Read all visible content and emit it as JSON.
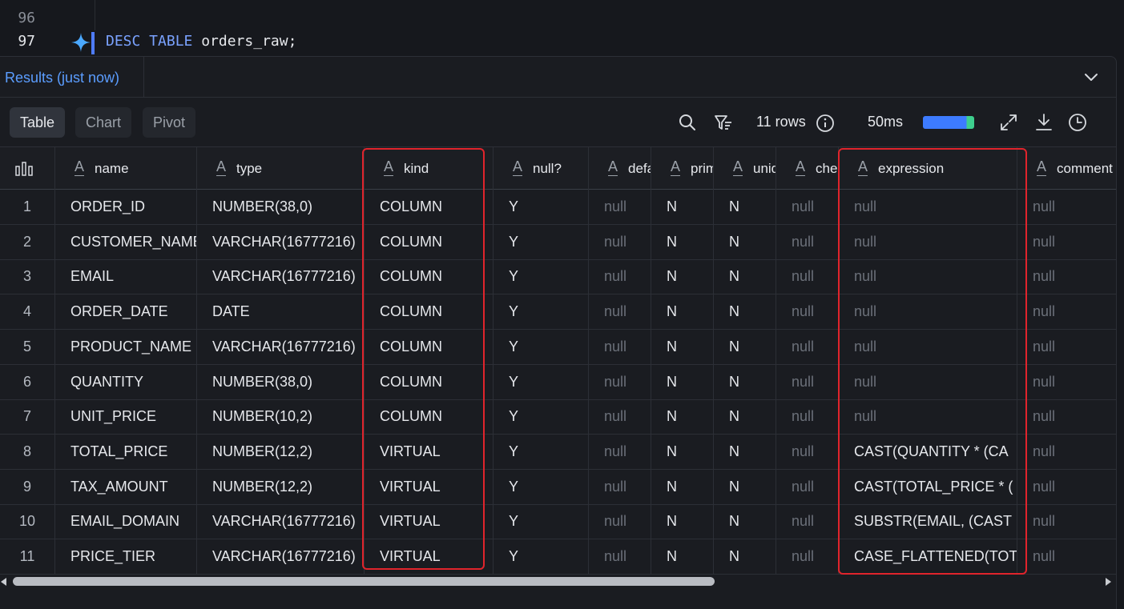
{
  "editor": {
    "lines": [
      "96",
      "97"
    ],
    "code_keyword": "DESC TABLE",
    "code_rest": " orders_raw;"
  },
  "results": {
    "tab_label": "Results (just now)"
  },
  "toolbar": {
    "tabs": [
      "Table",
      "Chart",
      "Pivot"
    ],
    "active_tab": "Table",
    "rows_count": "11 rows",
    "elapsed": "50ms",
    "progress": 1.0
  },
  "table": {
    "type_icon": "A",
    "columns": [
      "name",
      "type",
      "kind",
      "null?",
      "default",
      "primary key",
      "unique key",
      "check",
      "expression",
      "comment"
    ],
    "rows": [
      [
        "1",
        "ORDER_ID",
        "NUMBER(38,0)",
        "COLUMN",
        "Y",
        "null",
        "N",
        "N",
        "null",
        "null",
        "null"
      ],
      [
        "2",
        "CUSTOMER_NAME",
        "VARCHAR(16777216)",
        "COLUMN",
        "Y",
        "null",
        "N",
        "N",
        "null",
        "null",
        "null"
      ],
      [
        "3",
        "EMAIL",
        "VARCHAR(16777216)",
        "COLUMN",
        "Y",
        "null",
        "N",
        "N",
        "null",
        "null",
        "null"
      ],
      [
        "4",
        "ORDER_DATE",
        "DATE",
        "COLUMN",
        "Y",
        "null",
        "N",
        "N",
        "null",
        "null",
        "null"
      ],
      [
        "5",
        "PRODUCT_NAME",
        "VARCHAR(16777216)",
        "COLUMN",
        "Y",
        "null",
        "N",
        "N",
        "null",
        "null",
        "null"
      ],
      [
        "6",
        "QUANTITY",
        "NUMBER(38,0)",
        "COLUMN",
        "Y",
        "null",
        "N",
        "N",
        "null",
        "null",
        "null"
      ],
      [
        "7",
        "UNIT_PRICE",
        "NUMBER(10,2)",
        "COLUMN",
        "Y",
        "null",
        "N",
        "N",
        "null",
        "null",
        "null"
      ],
      [
        "8",
        "TOTAL_PRICE",
        "NUMBER(12,2)",
        "VIRTUAL",
        "Y",
        "null",
        "N",
        "N",
        "null",
        "CAST(QUANTITY * (CA",
        "null"
      ],
      [
        "9",
        "TAX_AMOUNT",
        "NUMBER(12,2)",
        "VIRTUAL",
        "Y",
        "null",
        "N",
        "N",
        "null",
        "CAST(TOTAL_PRICE * (",
        "null"
      ],
      [
        "10",
        "EMAIL_DOMAIN",
        "VARCHAR(16777216)",
        "VIRTUAL",
        "Y",
        "null",
        "N",
        "N",
        "null",
        "SUBSTR(EMAIL, (CAST",
        "null"
      ],
      [
        "11",
        "PRICE_TIER",
        "VARCHAR(16777216)",
        "VIRTUAL",
        "Y",
        "null",
        "N",
        "N",
        "null",
        "CASE_FLATTENED(TOT",
        "null"
      ]
    ]
  },
  "colors": {
    "accent": "#5b9dff",
    "highlight": "#e0242c",
    "null_text": "#6b7079"
  }
}
